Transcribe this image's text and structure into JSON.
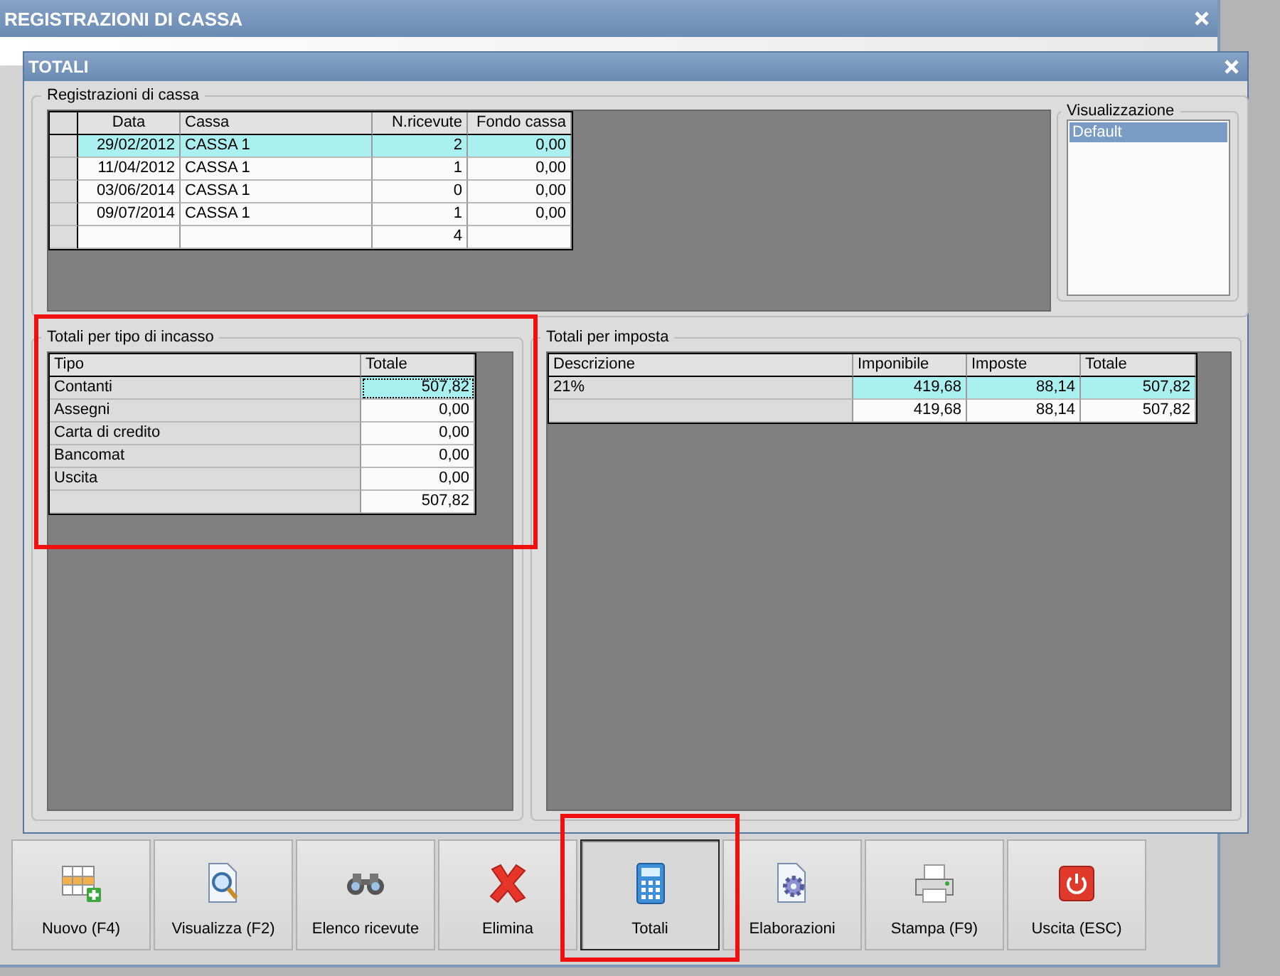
{
  "background_window": {
    "title": "REGISTRAZIONI DI CASSA"
  },
  "dialog": {
    "title": "TOTALI",
    "registrazioni": {
      "title": "Registrazioni di cassa",
      "row_headers": true,
      "columns": [
        {
          "label": "Data",
          "kind": "date"
        },
        {
          "label": "Cassa",
          "kind": "text"
        },
        {
          "label": "N.ricevute",
          "kind": "number"
        },
        {
          "label": "Fondo cassa",
          "kind": "number"
        }
      ],
      "rows": [
        {
          "cells": [
            "29/02/2012",
            "CASSA 1",
            "2",
            "0,00"
          ],
          "selected": true
        },
        {
          "cells": [
            "11/04/2012",
            "CASSA 1",
            "1",
            "0,00"
          ],
          "selected": false
        },
        {
          "cells": [
            "03/06/2014",
            "CASSA 1",
            "0",
            "0,00"
          ],
          "selected": false
        },
        {
          "cells": [
            "09/07/2014",
            "CASSA 1",
            "1",
            "0,00"
          ],
          "selected": false
        },
        {
          "cells": [
            "",
            "",
            "4",
            ""
          ],
          "selected": false
        }
      ]
    },
    "visualizzazione": {
      "title": "Visualizzazione",
      "items": [
        {
          "label": "Default",
          "selected": true
        }
      ]
    },
    "per_tipo": {
      "title": "Totali per tipo di incasso",
      "highlighted": true,
      "columns": [
        {
          "label": "Tipo",
          "kind": "label"
        },
        {
          "label": "Totale",
          "kind": "number"
        }
      ],
      "rows": [
        {
          "cells": [
            "Contanti",
            "507,82"
          ],
          "selected": true
        },
        {
          "cells": [
            "Assegni",
            "0,00"
          ],
          "selected": false
        },
        {
          "cells": [
            "Carta di credito",
            "0,00"
          ],
          "selected": false
        },
        {
          "cells": [
            "Bancomat",
            "0,00"
          ],
          "selected": false
        },
        {
          "cells": [
            "Uscita",
            "0,00"
          ],
          "selected": false
        },
        {
          "cells": [
            "",
            "507,82"
          ],
          "selected": false
        }
      ]
    },
    "per_imposta": {
      "title": "Totali per imposta",
      "columns": [
        {
          "label": "Descrizione",
          "kind": "label"
        },
        {
          "label": "Imponibile",
          "kind": "number"
        },
        {
          "label": "Imposte",
          "kind": "number"
        },
        {
          "label": "Totale",
          "kind": "number"
        }
      ],
      "rows": [
        {
          "cells": [
            "21%",
            "419,68",
            "88,14",
            "507,82"
          ],
          "selected": true
        },
        {
          "cells": [
            "",
            "419,68",
            "88,14",
            "507,82"
          ],
          "selected": false
        }
      ]
    }
  },
  "buttons": [
    {
      "label": "Nuovo (F4)",
      "kind": "new",
      "pressed": false
    },
    {
      "label": "Visualizza (F2)",
      "kind": "view",
      "pressed": false
    },
    {
      "label": "Elenco ricevute",
      "kind": "list",
      "pressed": false
    },
    {
      "label": "Elimina",
      "kind": "delete",
      "pressed": false
    },
    {
      "label": "Totali",
      "kind": "totals",
      "pressed": true,
      "highlighted": true
    },
    {
      "label": "Elaborazioni",
      "kind": "process",
      "pressed": false
    },
    {
      "label": "Stampa (F9)",
      "kind": "print",
      "pressed": false
    },
    {
      "label": "Uscita (ESC)",
      "kind": "exit",
      "pressed": false
    }
  ]
}
